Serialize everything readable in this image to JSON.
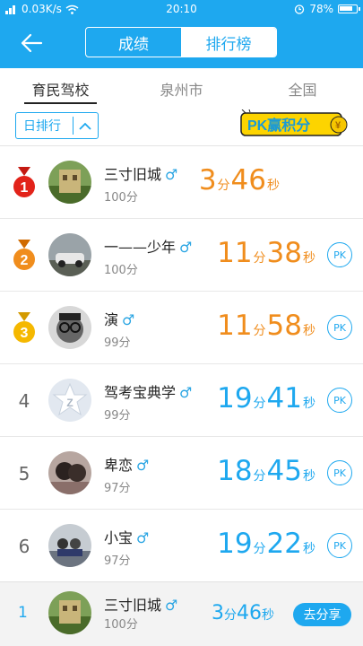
{
  "status_bar": {
    "signal": "0.03K/s",
    "time": "20:10",
    "battery": "78%"
  },
  "header": {
    "tabs": [
      "成绩",
      "排行榜"
    ],
    "active_tab": "排行榜"
  },
  "regions": [
    "育民驾校",
    "泉州市",
    "全国"
  ],
  "filter": {
    "label": "日排行"
  },
  "pk_banner": "PK赢积分",
  "units": {
    "min": "分",
    "sec": "秒"
  },
  "rows": [
    {
      "rank": "1",
      "name": "三寸旧城",
      "gender": "♂",
      "score": "100分",
      "min": "3",
      "sec": "46",
      "pk": ""
    },
    {
      "rank": "2",
      "name": "一——少年",
      "gender": "♂",
      "score": "100分",
      "min": "11",
      "sec": "38",
      "pk": "PK"
    },
    {
      "rank": "3",
      "name": "演",
      "gender": "♂",
      "score": "99分",
      "min": "11",
      "sec": "58",
      "pk": "PK"
    },
    {
      "rank": "4",
      "name": "驾考宝典学",
      "gender": "♂",
      "score": "99分",
      "min": "19",
      "sec": "41",
      "pk": "PK"
    },
    {
      "rank": "5",
      "name": "卑恋",
      "gender": "♂",
      "score": "97分",
      "min": "18",
      "sec": "45",
      "pk": "PK"
    },
    {
      "rank": "6",
      "name": "小宝",
      "gender": "♂",
      "score": "97分",
      "min": "19",
      "sec": "22",
      "pk": "PK"
    }
  ],
  "me": {
    "rank": "1",
    "name": "三寸旧城",
    "gender": "♂",
    "score": "100分",
    "min": "3",
    "sec": "46",
    "share": "去分享"
  },
  "colors": {
    "accent": "#1ea8ef",
    "orange": "#f08d1d",
    "gold": "#f5b800",
    "red": "#e2231a"
  }
}
